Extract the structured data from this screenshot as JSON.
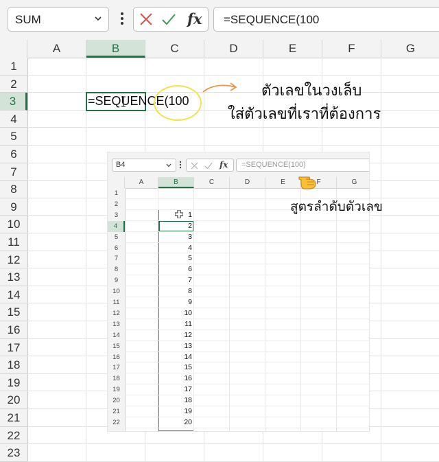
{
  "formula_bar": {
    "name_box": "SUM",
    "formula": "=SEQUENCE(100",
    "cancel_icon": "x-icon",
    "enter_icon": "check-icon",
    "function_label": "fx"
  },
  "grid": {
    "columns": [
      "A",
      "B",
      "C",
      "D",
      "E",
      "F",
      "G"
    ],
    "rows": [
      "1",
      "2",
      "3",
      "4",
      "5",
      "6",
      "7",
      "8",
      "9",
      "10",
      "11",
      "12",
      "13",
      "14",
      "15",
      "16",
      "17",
      "18",
      "19",
      "20",
      "21",
      "22",
      "23"
    ],
    "active_cell_text": "=SEQUENCE(100"
  },
  "annotations": {
    "line1": "ตัวเลขในวงเล็บ",
    "line2": "ใส่ตัวเลขที่เราที่ต้องการ",
    "line3": "สูตรลำดับตัวเลข"
  },
  "inset": {
    "name_box": "B4",
    "formula": "=SEQUENCE(100)",
    "function_label": "fx",
    "columns": [
      "A",
      "B",
      "C",
      "D",
      "E",
      "F",
      "G"
    ],
    "rows": [
      "1",
      "2",
      "3",
      "4",
      "5",
      "6",
      "7",
      "8",
      "9",
      "10",
      "11",
      "12",
      "13",
      "14",
      "15",
      "16",
      "17",
      "18",
      "19",
      "20",
      "21",
      "22"
    ],
    "values": [
      "1",
      "2",
      "3",
      "4",
      "5",
      "6",
      "7",
      "8",
      "9",
      "10",
      "11",
      "12",
      "13",
      "14",
      "15",
      "16",
      "17",
      "18",
      "19",
      "20"
    ]
  },
  "colors": {
    "excel_green": "#217346",
    "highlight_yellow": "#f3e34a",
    "arrow_orange": "#e8964a",
    "cancel_red": "#d9534f"
  }
}
